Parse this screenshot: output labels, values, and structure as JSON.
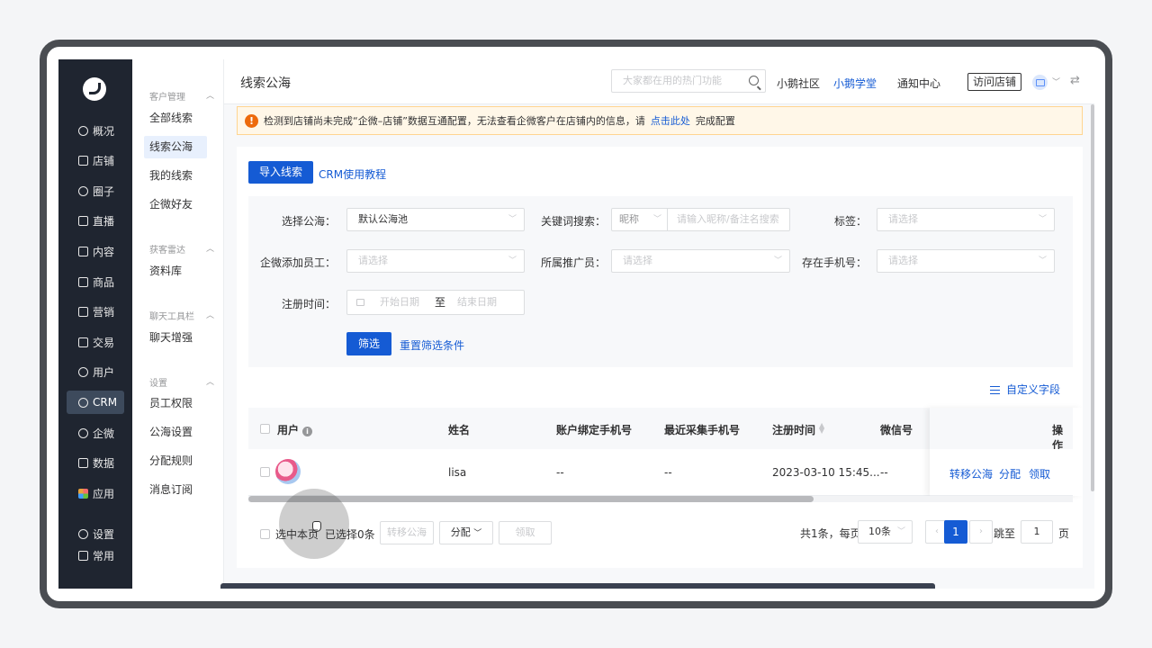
{
  "rail": {
    "items": [
      {
        "label": "概况",
        "icon": "dashboard-icon"
      },
      {
        "label": "店铺",
        "icon": "shop-icon"
      },
      {
        "label": "圈子",
        "icon": "group-icon"
      },
      {
        "label": "直播",
        "icon": "live-icon"
      },
      {
        "label": "内容",
        "icon": "content-icon"
      },
      {
        "label": "商品",
        "icon": "goods-icon"
      },
      {
        "label": "营销",
        "icon": "megaphone-icon"
      },
      {
        "label": "交易",
        "icon": "trade-icon"
      },
      {
        "label": "用户",
        "icon": "user-icon"
      },
      {
        "label": "CRM",
        "icon": "crm-icon"
      },
      {
        "label": "企微",
        "icon": "wecom-icon"
      },
      {
        "label": "数据",
        "icon": "data-icon"
      },
      {
        "label": "应用",
        "icon": "apps-icon"
      },
      {
        "label": "设置",
        "icon": "gear-icon"
      },
      {
        "label": "常用",
        "icon": "list-icon"
      }
    ],
    "active": "CRM"
  },
  "submenu": {
    "groups": [
      {
        "title": "客户管理",
        "items": [
          "全部线索",
          "线索公海",
          "我的线索",
          "企微好友"
        ]
      },
      {
        "title": "获客雷达",
        "items": [
          "资料库"
        ]
      },
      {
        "title": "聊天工具栏",
        "items": [
          "聊天增强"
        ]
      },
      {
        "title": "设置",
        "items": [
          "员工权限",
          "公海设置",
          "分配规则",
          "消息订阅"
        ]
      }
    ],
    "active": "线索公海"
  },
  "topbar": {
    "title": "线索公海",
    "search_placeholder": "大家都在用的热门功能",
    "community": "小鹅社区",
    "academy": "小鹅学堂",
    "notice_center": "通知中心",
    "visit_store": "访问店铺"
  },
  "notice": {
    "text": "检测到店铺尚未完成“企微–店铺”数据互通配置，无法查看企微客户在店铺内的信息，请",
    "link": "点击此处",
    "suffix": "完成配置"
  },
  "actions": {
    "import": "导入线索",
    "tutorial": "CRM使用教程"
  },
  "filters": {
    "pool_label": "选择公海：",
    "pool_value": "默认公海池",
    "keyword_label": "关键词搜索：",
    "keyword_type": "昵称",
    "keyword_placeholder": "请输入昵称/备注名搜索",
    "tag_label": "标签：",
    "tag_placeholder": "请选择",
    "staff_label": "企微添加员工：",
    "staff_placeholder": "请选择",
    "promoter_label": "所属推广员：",
    "promoter_placeholder": "请选择",
    "phone_label": "存在手机号：",
    "phone_placeholder": "请选择",
    "reg_label": "注册时间：",
    "start_placeholder": "开始日期",
    "to": "至",
    "end_placeholder": "结束日期",
    "filter_btn": "筛选",
    "reset": "重置筛选条件"
  },
  "custom_fields": "自定义字段",
  "table": {
    "headers": {
      "user": "用户",
      "name": "姓名",
      "bound_phone": "账户绑定手机号",
      "recent_phone": "最近采集手机号",
      "reg_time": "注册时间",
      "wechat": "微信号",
      "ops": "操作"
    },
    "rows": [
      {
        "name": "lisa",
        "bound_phone": "--",
        "recent_phone": "--",
        "reg_time": "2023-03-10 15:45...",
        "wechat": "--",
        "ops": [
          "转移公海",
          "分配",
          "领取"
        ]
      }
    ]
  },
  "footer": {
    "select_page": "选中本页",
    "selected": "已选择0条",
    "transfer": "转移公海",
    "assign": "分配",
    "claim": "领取",
    "total": "共1条，每页",
    "page_size": "10条",
    "current_page": "1",
    "jump_to": "跳至",
    "jump_value": "1",
    "page_unit": "页"
  },
  "colors": {
    "primary": "#155bd4",
    "rail": "#1f2530",
    "warning": "#ed6a0c"
  }
}
